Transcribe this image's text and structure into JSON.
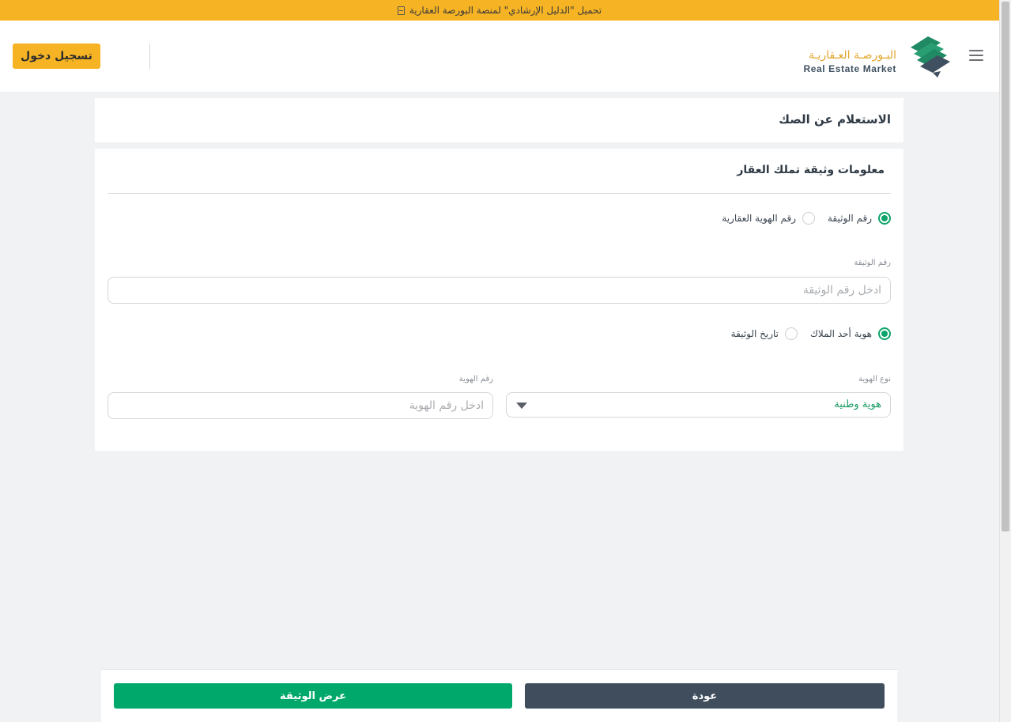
{
  "banner": {
    "text": "تحميل \"الدليل الإرشادي\" لمنصة البورصة العقارية",
    "icon": "pdf-document-icon"
  },
  "header": {
    "logo_ar": "البـورصـة العـقاريـة",
    "logo_en": "Real Estate Market",
    "login_label": "تسجيل دخول",
    "menu_icon": "hamburger-menu-icon",
    "brand_colors": {
      "gold": "#f6b324",
      "green": "#1f8a63",
      "navy": "#3f5160"
    }
  },
  "page": {
    "title": "الاستعلام عن الصك"
  },
  "form": {
    "section_title": "معلومات وثيقة تملك العقار",
    "search_type": {
      "options": [
        {
          "label": "رقم الوثيقة",
          "checked": true
        },
        {
          "label": "رقم الهوية العقارية",
          "checked": false
        }
      ]
    },
    "document_number": {
      "label": "رقم الوثيقة",
      "placeholder": "ادخل رقم الوثيقة",
      "value": ""
    },
    "verify_type": {
      "options": [
        {
          "label": "هوية أحد الملاك",
          "checked": true
        },
        {
          "label": "تاريخ الوثيقة",
          "checked": false
        }
      ]
    },
    "id_type": {
      "label": "نوع الهوية",
      "selected": "هوية وطنية"
    },
    "id_number": {
      "label": "رقم الهوية",
      "placeholder": "ادخل رقم الهوية",
      "value": ""
    }
  },
  "footer": {
    "back_label": "عودة",
    "view_label": "عرض الوثيقة",
    "colors": {
      "back": "#3f4d5c",
      "view": "#00a86b"
    }
  }
}
